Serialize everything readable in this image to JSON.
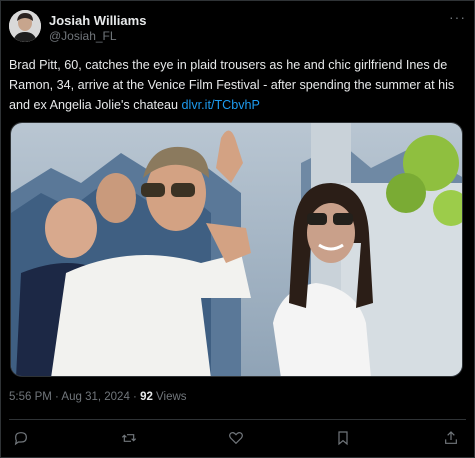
{
  "author": {
    "name": "Josiah Williams",
    "handle": "@Josiah_FL"
  },
  "tweet": {
    "text": "Brad Pitt, 60, catches the eye in plaid trousers as he and chic girlfriend Ines de Ramon, 34, arrive at the Venice Film Festival - after spending the summer at his and ex Angelia Jolie's chateau ",
    "link": "dlvr.it/TCbvhP"
  },
  "meta": {
    "timestamp": "5:56 PM · Aug 31, 2024 · ",
    "views_count": "92",
    "views_label": " Views"
  },
  "icons": [
    "more-icon",
    "reply-icon",
    "retweet-icon",
    "like-icon",
    "bookmark-icon",
    "share-icon"
  ],
  "colors": {
    "background": "#000000",
    "text": "#e7e9ea",
    "muted": "#71767b",
    "link": "#1d9bf0",
    "border": "#2f3336"
  }
}
